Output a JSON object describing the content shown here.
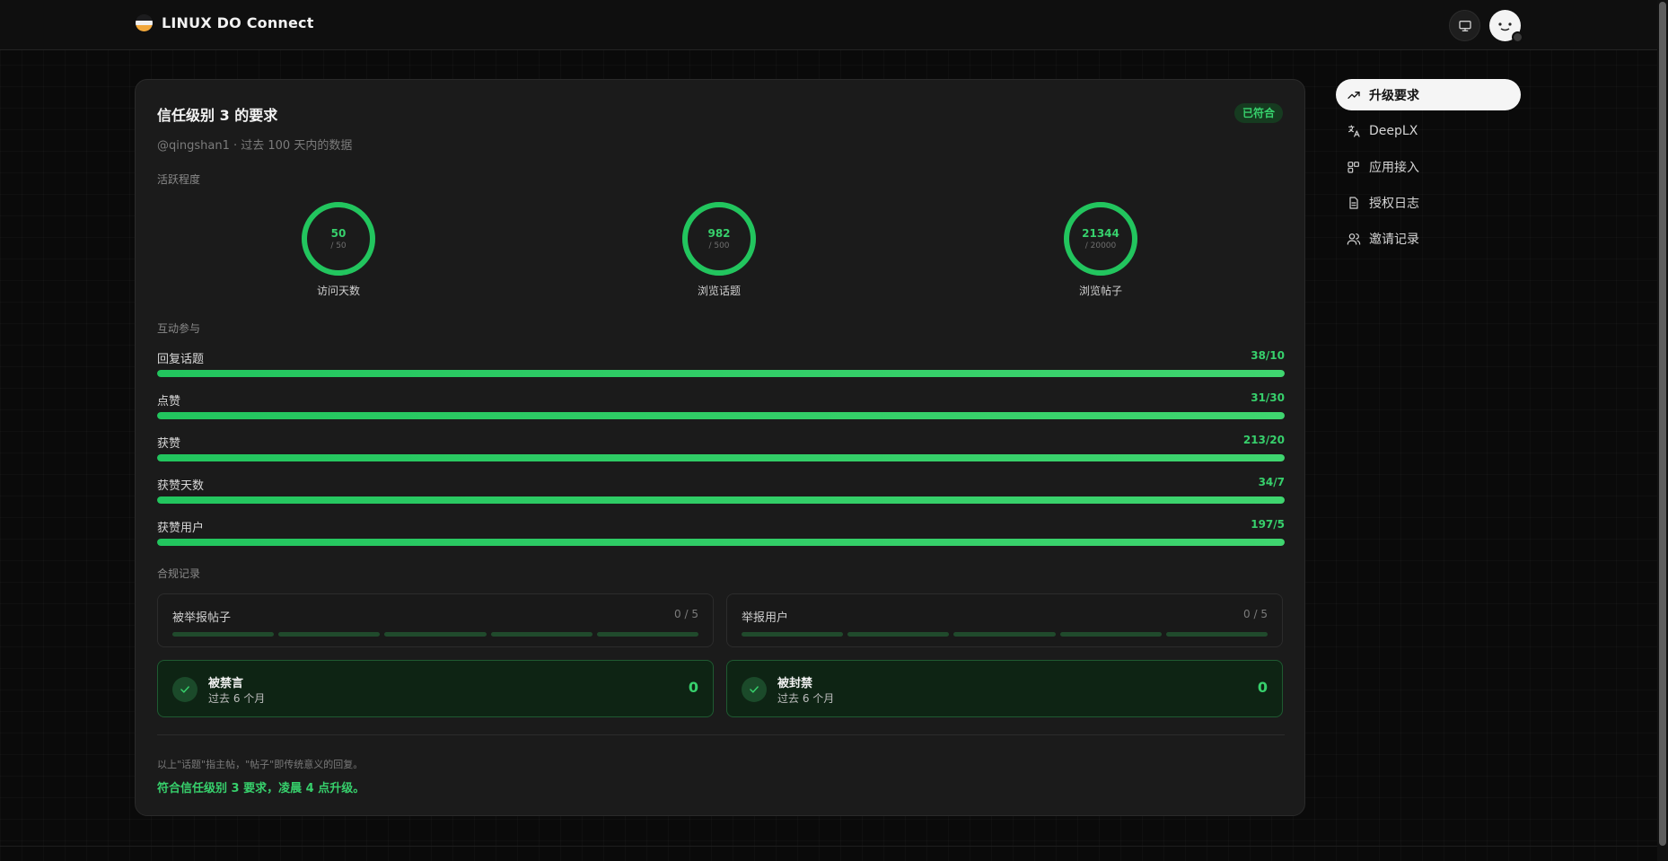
{
  "header": {
    "brand": "LINUX DO Connect",
    "icons": {
      "logo": "linux-do-logo",
      "monitor": "monitor-icon",
      "avatar": "user-avatar"
    }
  },
  "card": {
    "title": "信任级别 3 的要求",
    "status": "已符合",
    "subtitle": "@qingshan1 · 过去 100 天内的数据",
    "sections": {
      "activity": "活跃程度",
      "interaction": "互动参与",
      "compliance": "合规记录"
    },
    "rings": [
      {
        "label": "访问天数",
        "value": "50",
        "target": "/ 50",
        "progress": 1.0
      },
      {
        "label": "浏览话题",
        "value": "982",
        "target": "/ 500",
        "progress": 1.0
      },
      {
        "label": "浏览帖子",
        "value": "21344",
        "target": "/ 20000",
        "progress": 1.0
      }
    ],
    "bars": [
      {
        "label": "回复话题",
        "value": "38/10",
        "progress": 1.0
      },
      {
        "label": "点赞",
        "value": "31/30",
        "progress": 1.0
      },
      {
        "label": "获赞",
        "value": "213/20",
        "progress": 1.0
      },
      {
        "label": "获赞天数",
        "value": "34/7",
        "progress": 1.0
      },
      {
        "label": "获赞用户",
        "value": "197/5",
        "progress": 1.0
      }
    ],
    "reports": [
      {
        "label": "被举报帖子",
        "count": "0 / 5"
      },
      {
        "label": "举报用户",
        "count": "0 / 5"
      }
    ],
    "bans": [
      {
        "title": "被禁言",
        "sub": "过去 6 个月",
        "count": "0"
      },
      {
        "title": "被封禁",
        "sub": "过去 6 个月",
        "count": "0"
      }
    ],
    "note": "以上\"话题\"指主帖，\"帖子\"即传统意义的回复。",
    "conclusion": "符合信任级别 3 要求，凌晨 4 点升级。"
  },
  "nav": {
    "items": [
      {
        "label": "升级要求",
        "icon": "trending-up-icon",
        "active": true
      },
      {
        "label": "DeepLX",
        "icon": "translate-icon",
        "active": false
      },
      {
        "label": "应用接入",
        "icon": "apps-icon",
        "active": false
      },
      {
        "label": "授权日志",
        "icon": "document-icon",
        "active": false
      },
      {
        "label": "邀请记录",
        "icon": "users-icon",
        "active": false
      }
    ]
  },
  "colors": {
    "accent": "#37d06c",
    "background": "#0a0a0a",
    "card": "#1b1b1b"
  }
}
